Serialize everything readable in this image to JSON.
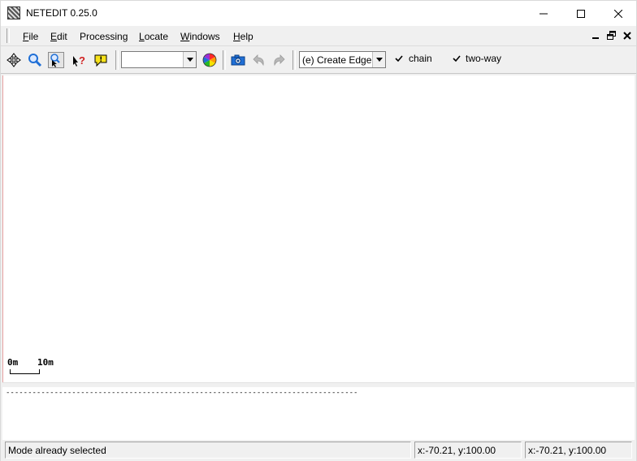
{
  "window": {
    "title": "NETEDIT 0.25.0",
    "controls": {
      "minimize": "minimize-icon",
      "maximize": "maximize-icon",
      "close": "close-icon"
    }
  },
  "menubar": {
    "items": [
      {
        "mnemonic": "F",
        "rest": "ile"
      },
      {
        "mnemonic": "E",
        "rest": "dit"
      },
      {
        "mnemonic": "",
        "rest": "Processing"
      },
      {
        "mnemonic": "L",
        "rest": "ocate"
      },
      {
        "mnemonic": "W",
        "rest": "indows"
      },
      {
        "mnemonic": "H",
        "rest": "elp"
      }
    ]
  },
  "toolbar": {
    "icons": [
      "recenter-view-icon",
      "zoom-icon",
      "locate-cursor-icon",
      "help-icon",
      "tooltip-icon",
      "color-wheel-icon",
      "screenshot-icon",
      "undo-icon",
      "redo-icon"
    ],
    "viewport_combo_value": "",
    "mode_combo_value": "(e) Create Edge",
    "chain_label": "chain",
    "chain_checked": true,
    "two_way_label": "two-way",
    "two_way_checked": true
  },
  "canvas": {
    "scale_zero": "0m",
    "scale_ten": "10m"
  },
  "messages": {
    "separator_line": "--------------------------------------------------------------------------------"
  },
  "statusbar": {
    "message": "Mode already selected",
    "coords_1": "x:-70.21, y:100.00",
    "coords_2": "x:-70.21, y:100.00"
  },
  "colors": {
    "background": "#f0f0f0",
    "canvas": "#ffffff",
    "accent_blue": "#1f6fd6",
    "help_red": "#d02020",
    "tooltip_yellow": "#f7e21b"
  }
}
